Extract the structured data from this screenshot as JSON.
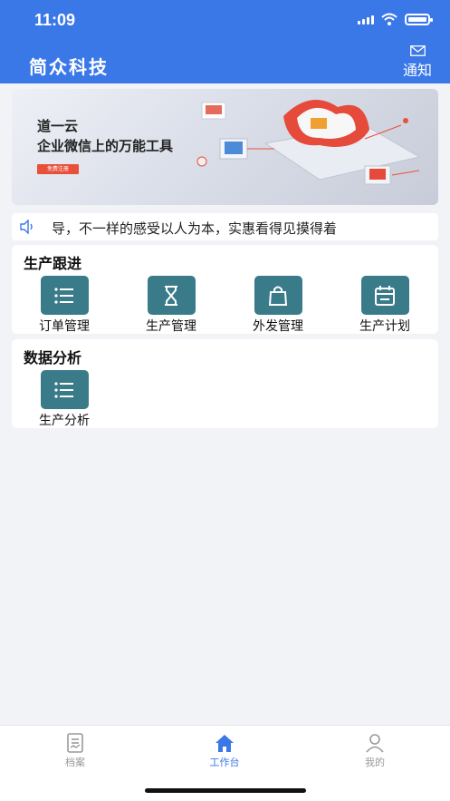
{
  "status_bar": {
    "time": "11:09"
  },
  "header": {
    "title": "简众科技",
    "notice_label": "通知"
  },
  "banner": {
    "title": "道一云",
    "subtitle": "企业微信上的万能工具",
    "button_label": "免费注册"
  },
  "marquee": {
    "text": "导，不一样的感受以人为本，实惠看得见摸得着"
  },
  "sections": [
    {
      "title": "生产跟进",
      "items": [
        {
          "label": "订单管理",
          "icon": "list-icon"
        },
        {
          "label": "生产管理",
          "icon": "hourglass-icon"
        },
        {
          "label": "外发管理",
          "icon": "bag-icon"
        },
        {
          "label": "生产计划",
          "icon": "calendar-icon"
        }
      ]
    },
    {
      "title": "数据分析",
      "items": [
        {
          "label": "生产分析",
          "icon": "list-icon"
        }
      ]
    }
  ],
  "tabbar": {
    "tabs": [
      {
        "label": "档案",
        "icon": "archive-icon",
        "active": false
      },
      {
        "label": "工作台",
        "icon": "home-icon",
        "active": true
      },
      {
        "label": "我的",
        "icon": "user-icon",
        "active": false
      }
    ]
  },
  "colors": {
    "primary": "#3b78e7",
    "tile": "#3a7b8a",
    "background": "#f2f3f7"
  }
}
